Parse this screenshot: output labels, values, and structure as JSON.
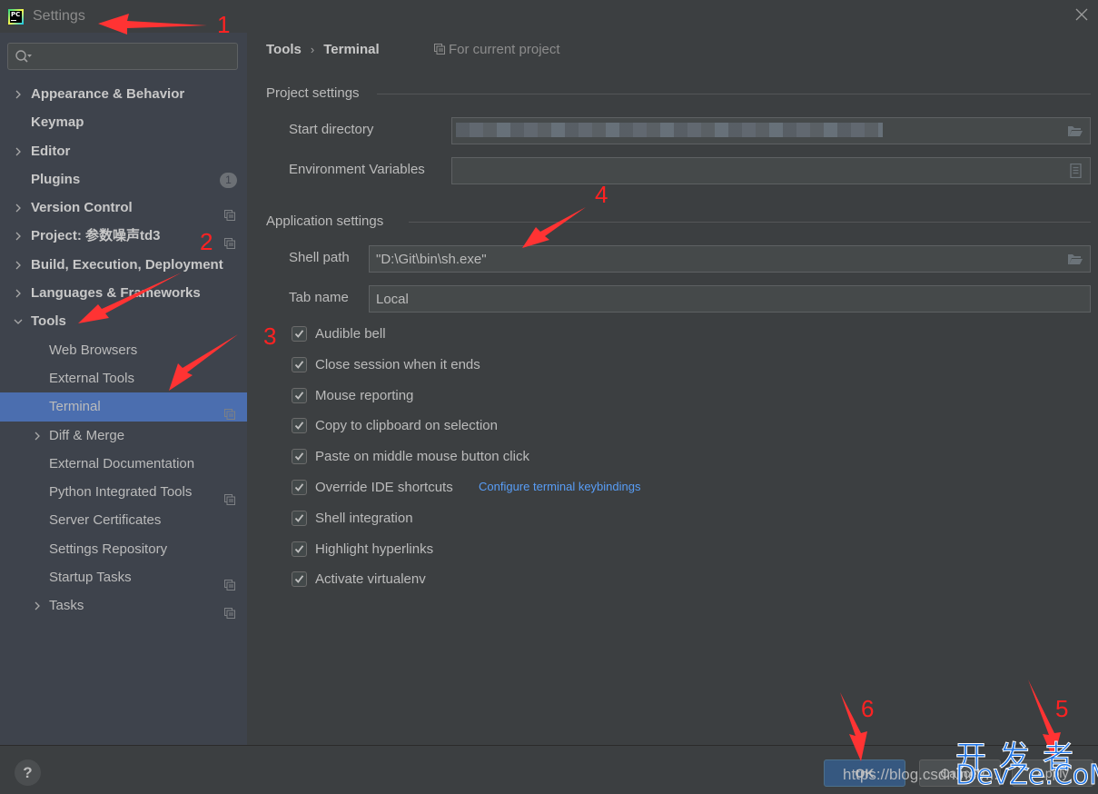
{
  "window": {
    "title": "Settings",
    "app_icon": "pycharm-logo",
    "app_icon_text": "PC",
    "close_icon": "close-icon"
  },
  "sidebar": {
    "search": {
      "placeholder": "",
      "value": ""
    },
    "items": [
      {
        "label": "Appearance & Behavior",
        "level": 0,
        "expandable": true,
        "expanded": false
      },
      {
        "label": "Keymap",
        "level": 0,
        "expandable": false
      },
      {
        "label": "Editor",
        "level": 0,
        "expandable": true,
        "expanded": false
      },
      {
        "label": "Plugins",
        "level": 0,
        "expandable": false,
        "badge": "1"
      },
      {
        "label": "Version Control",
        "level": 0,
        "expandable": true,
        "expanded": false,
        "project_icon": true
      },
      {
        "label": "Project: 参数噪声td3",
        "level": 0,
        "expandable": true,
        "expanded": false,
        "project_icon": true
      },
      {
        "label": "Build, Execution, Deployment",
        "level": 0,
        "expandable": true,
        "expanded": false
      },
      {
        "label": "Languages & Frameworks",
        "level": 0,
        "expandable": true,
        "expanded": false
      },
      {
        "label": "Tools",
        "level": 0,
        "expandable": true,
        "expanded": true
      },
      {
        "label": "Web Browsers",
        "level": 1,
        "expandable": false
      },
      {
        "label": "External Tools",
        "level": 1,
        "expandable": false
      },
      {
        "label": "Terminal",
        "level": 1,
        "expandable": false,
        "selected": true,
        "project_icon": true
      },
      {
        "label": "Diff & Merge",
        "level": 1,
        "expandable": true,
        "expanded": false
      },
      {
        "label": "External Documentation",
        "level": 1,
        "expandable": false
      },
      {
        "label": "Python Integrated Tools",
        "level": 1,
        "expandable": false,
        "project_icon": true
      },
      {
        "label": "Server Certificates",
        "level": 1,
        "expandable": false
      },
      {
        "label": "Settings Repository",
        "level": 1,
        "expandable": false
      },
      {
        "label": "Startup Tasks",
        "level": 1,
        "expandable": false,
        "project_icon": true
      },
      {
        "label": "Tasks",
        "level": 1,
        "expandable": true,
        "expanded": false,
        "project_icon": true
      }
    ]
  },
  "main": {
    "breadcrumb": [
      "Tools",
      "Terminal"
    ],
    "breadcrumb_separator": "›",
    "scope_label": "For current project",
    "project_settings": {
      "title": "Project settings",
      "start_directory_label": "Start directory",
      "start_directory_value": "",
      "start_directory_blurred": true,
      "env_vars_label": "Environment Variables",
      "env_vars_value": ""
    },
    "application_settings": {
      "title": "Application settings",
      "shell_path_label": "Shell path",
      "shell_path_value": "\"D:\\Git\\bin\\sh.exe\"",
      "tab_name_label": "Tab name",
      "tab_name_value": "Local"
    },
    "checkboxes": [
      {
        "label": "Audible bell",
        "checked": true
      },
      {
        "label": "Close session when it ends",
        "checked": true
      },
      {
        "label": "Mouse reporting",
        "checked": true
      },
      {
        "label": "Copy to clipboard on selection",
        "checked": true
      },
      {
        "label": "Paste on middle mouse button click",
        "checked": true
      },
      {
        "label": "Override IDE shortcuts",
        "checked": true
      },
      {
        "label": "Shell integration",
        "checked": true
      },
      {
        "label": "Highlight hyperlinks",
        "checked": true
      },
      {
        "label": "Activate virtualenv",
        "checked": true
      }
    ],
    "keybindings_link": "Configure terminal keybindings"
  },
  "footer": {
    "help_label": "?",
    "ok_label": "OK",
    "cancel_label": "Cancel",
    "apply_label": "Apply"
  },
  "annotations": [
    "1",
    "2",
    "3",
    "4",
    "5",
    "6"
  ],
  "watermark": {
    "url": "https://blog.csdn.net/...",
    "cn_text": "开发者",
    "site": "DevZe.CoM"
  },
  "colors": {
    "selection": "#4b6eaf",
    "link": "#589df6",
    "ok_button": "#365880",
    "annotation": "#ff2222"
  }
}
